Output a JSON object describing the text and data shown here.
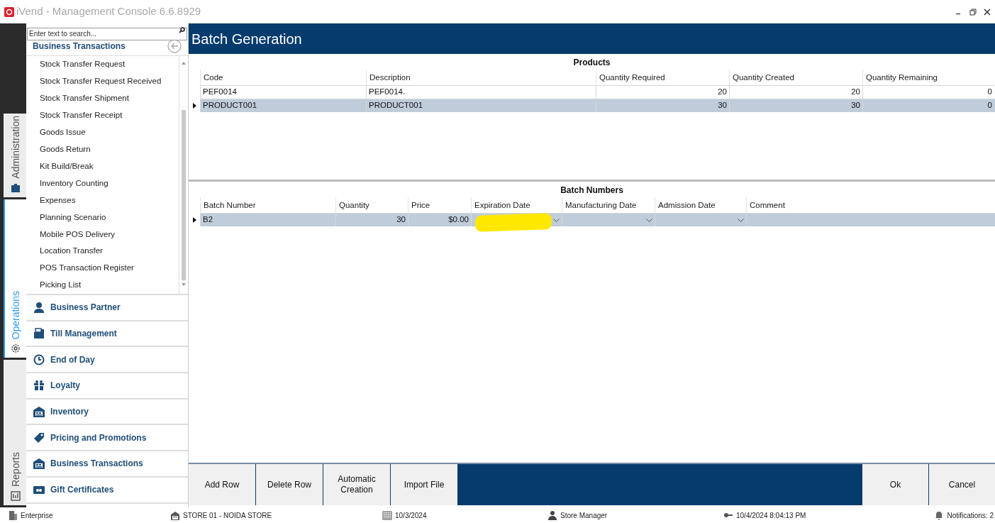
{
  "window": {
    "title": "iVend - Management Console  6.6.8929"
  },
  "side_tabs": [
    {
      "label": "Administration",
      "selected": false
    },
    {
      "label": "Operations",
      "selected": true
    },
    {
      "label": "Reports",
      "selected": false
    }
  ],
  "nav": {
    "search": {
      "placeholder": "Enter text to search..."
    },
    "header": "Business Transactions",
    "items": [
      "Stock Transfer Request",
      "Stock Transfer Request Received",
      "Stock Transfer Shipment",
      "Stock Transfer Receipt",
      "Goods Issue",
      "Goods Return",
      "Kit Build/Break",
      "Inventory Counting",
      "Expenses",
      "Planning Scenario",
      "Mobile POS Delivery",
      "Location Transfer",
      "POS Transaction Register",
      "Picking List"
    ],
    "groups": [
      {
        "label": "Business Partner",
        "kind": "partner"
      },
      {
        "label": "Till Management",
        "kind": "till"
      },
      {
        "label": "End of Day",
        "kind": "clock"
      },
      {
        "label": "Loyalty",
        "kind": "gift"
      },
      {
        "label": "Inventory",
        "kind": "warehouse"
      },
      {
        "label": "Pricing and Promotions",
        "kind": "tag"
      },
      {
        "label": "Business Transactions",
        "kind": "warehouse"
      },
      {
        "label": "Gift Certificates",
        "kind": "card"
      }
    ]
  },
  "page": {
    "title": "Batch Generation"
  },
  "products": {
    "title": "Products",
    "columns": [
      "Code",
      "Description",
      "Quantity Required",
      "Quantity Created",
      "Quantity Remaining"
    ],
    "rows": [
      {
        "cells": [
          "PEF0014",
          "PEF0014.",
          "20",
          "20",
          "0"
        ],
        "selected": false
      },
      {
        "cells": [
          "PRODUCT001",
          "PRODUCT001",
          "30",
          "30",
          "0"
        ],
        "selected": true
      }
    ]
  },
  "batches": {
    "title": "Batch Numbers",
    "columns": [
      "Batch Number",
      "Quantity",
      "Price",
      "Expiration Date",
      "Manufacturing Date",
      "Admission Date",
      "Comment"
    ],
    "rows": [
      {
        "cells": [
          "B2",
          "30",
          "$0.00",
          "",
          "",
          "",
          ""
        ],
        "selected": true
      }
    ]
  },
  "annotation": {
    "kind": "highlighter"
  },
  "buttons_left": [
    "Add Row",
    "Delete Row",
    "Automatic Creation",
    "Import File"
  ],
  "buttons_right": [
    "Ok",
    "Cancel"
  ],
  "status_bar": [
    {
      "text": "Enterprise",
      "kind": "building"
    },
    {
      "text": "STORE 01 - NOIDA STORE",
      "kind": "store"
    },
    {
      "text": "10/3/2024",
      "kind": "calendar"
    },
    {
      "text": "Store Manager",
      "kind": "user"
    },
    {
      "text": "10/4/2024 8:04:13 PM",
      "kind": "key"
    },
    {
      "text": "Notifications: 2",
      "kind": "bell"
    }
  ]
}
